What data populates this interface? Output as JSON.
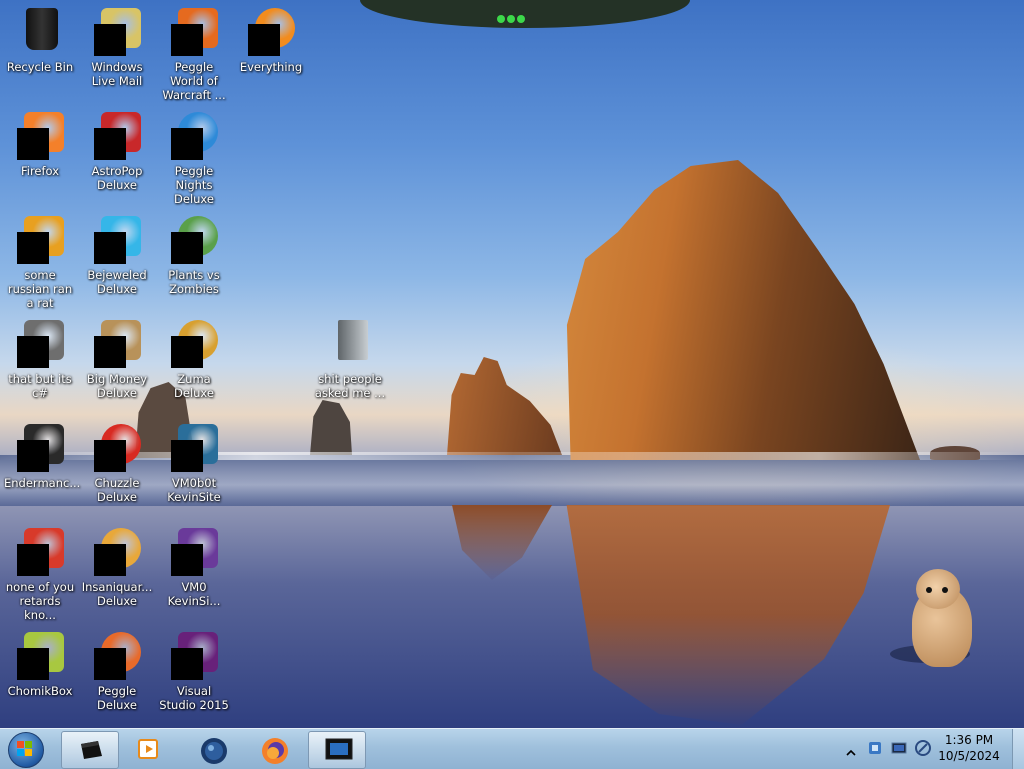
{
  "desktop": {
    "wallpaper": "sea-stack-beach-sunset",
    "icons": [
      {
        "label": "Recycle Bin",
        "icon": "recycle-bin-icon",
        "color": "#1a1a1a"
      },
      {
        "label": "Windows Live Mail",
        "icon": "mail-icon",
        "color": "#d8c466"
      },
      {
        "label": "Peggle World of Warcraft ...",
        "icon": "peggle-wow-icon",
        "color": "#e56a1f"
      },
      {
        "label": "Everything",
        "icon": "search-everything-icon",
        "color": "#f28c1e"
      },
      {
        "label": "Firefox",
        "icon": "firefox-icon",
        "color": "#f4802a"
      },
      {
        "label": "AstroPop Deluxe",
        "icon": "astropop-icon",
        "color": "#c8282a"
      },
      {
        "label": "Peggle Nights Deluxe",
        "icon": "peggle-nights-icon",
        "color": "#2e8ad8"
      },
      {
        "label": "some russian ran a rat",
        "icon": "ie-folder-icon",
        "color": "#e8a020"
      },
      {
        "label": "Bejeweled Deluxe",
        "icon": "bejeweled-icon",
        "color": "#35b6e8"
      },
      {
        "label": "Plants vs Zombies",
        "icon": "pvz-icon",
        "color": "#5aa04a"
      },
      {
        "label": "that but its c#",
        "icon": "stacked-windows-icon",
        "color": "#6e6e6e"
      },
      {
        "label": "Big Money Deluxe",
        "icon": "money-bag-icon",
        "color": "#b8925a"
      },
      {
        "label": "Zuma Deluxe",
        "icon": "zuma-icon",
        "color": "#d8a030"
      },
      {
        "label": "shit people asked me ...",
        "icon": "folder-icon",
        "color": "#9aa2a8"
      },
      {
        "label": "Endermanc...",
        "icon": "terminal-window-icon",
        "color": "#2a2a2a"
      },
      {
        "label": "Chuzzle Deluxe",
        "icon": "chuzzle-icon",
        "color": "#d82a22"
      },
      {
        "label": "VM0b0t KevinSite",
        "icon": "vm-window-icon",
        "color": "#2a6e9a"
      },
      {
        "label": "none of you retards kno...",
        "icon": "peggle-ball-icon",
        "color": "#d83a2a"
      },
      {
        "label": "Insaniquar... Deluxe",
        "icon": "insaniquarium-icon",
        "color": "#e8a83a"
      },
      {
        "label": "VM0 KevinSi...",
        "icon": "visual-studio-icon",
        "color": "#6a3a9a"
      },
      {
        "label": "ChomikBox",
        "icon": "chomikbox-icon",
        "color": "#a8c840"
      },
      {
        "label": "Peggle Deluxe",
        "icon": "peggle-icon",
        "color": "#e86a2a"
      },
      {
        "label": "Visual Studio 2015",
        "icon": "visual-studio-icon",
        "color": "#68217a"
      }
    ]
  },
  "taskbar": {
    "start_icon": "windows-start-orb-icon",
    "apps": [
      {
        "icon": "terminal-window-icon",
        "active": true
      },
      {
        "icon": "media-player-icon",
        "active": false
      },
      {
        "icon": "globe-icon",
        "active": false
      },
      {
        "icon": "firefox-icon",
        "active": false
      },
      {
        "icon": "vm-window-icon",
        "active": true
      }
    ],
    "tray_icons": [
      "show-hidden-icons-chevron",
      "network-icon",
      "display-icon",
      "connection-icon"
    ],
    "clock": {
      "time": "1:36 PM",
      "date": "10/5/2024"
    }
  }
}
